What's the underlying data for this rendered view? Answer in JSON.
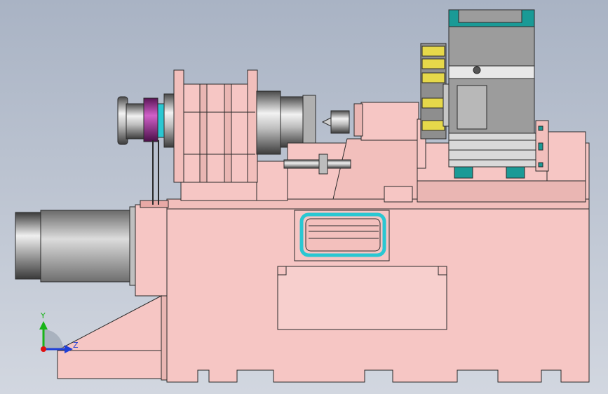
{
  "triad": {
    "y_label": "Y",
    "z_label": "Z",
    "colors": {
      "y": "#18b418",
      "z": "#1f3fd6",
      "origin": "#e01010"
    }
  },
  "colors": {
    "background_top": "#a9b3c4",
    "background_bottom": "#cfd5df",
    "casting": "#f6c6c4",
    "casting_dark": "#e8a9a6",
    "outline": "#2a2a2a",
    "steel_light": "#e6e6e6",
    "steel_mid": "#a8a8a8",
    "steel_dark": "#555555",
    "cyan": "#29c7d2",
    "teal": "#1a9a96",
    "magenta": "#a0309a",
    "turret_yellow": "#e6d84a",
    "turret_gray": "#8e8e8e",
    "motor_gray": "#9a9a9a"
  }
}
